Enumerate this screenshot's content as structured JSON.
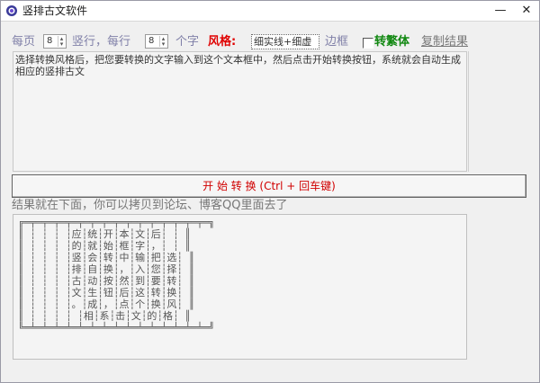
{
  "window": {
    "title": "竖排古文软件",
    "minimize_glyph": "—",
    "close_glyph": "✕"
  },
  "toolbar": {
    "per_page_label": "每页",
    "columns_value": "8",
    "columns_suffix": "竖行，每行",
    "chars_value": "8",
    "chars_suffix": "个字",
    "style_label": "风格:",
    "style_value": "细实线+细虚",
    "border_label": "边框",
    "traditional_checked": false,
    "traditional_label": "转繁体",
    "copy_label": "复制结果"
  },
  "input": {
    "text": "选择转换风格后，把您要转换的文字输入到这个文本框中，然后点击开始转换按钮，系统就会自动生成相应的竖排古文"
  },
  "start_button": {
    "label": "开 始 转 换  (Ctrl + 回车键)"
  },
  "result": {
    "label": "结果就在下面，你可以拷贝到论坛、博客QQ里面去了",
    "output_text": "╔═╤═╤═╤═╤═╤═╤═╤═╤═╤═╤═╤═╤═╤═╤═╤═╗\n║ ┆ ┆ ┆ ┆应┆统┆开┆本┆文┆后┆ ┆ ║\n║ ┆ ┆ ┆ ┆的┆就┆始┆框┆字┆，┆ ┆ ║\n║ ┆ ┆ ┆ ┆竖┆会┆转┆中┆输┆把┆选┆ ║\n║ ┆ ┆ ┆ ┆排┆自┆换┆，┆入┆您┆择┆ ║\n║ ┆ ┆ ┆ ┆古┆动┆按┆然┆到┆要┆转┆ ║\n║ ┆ ┆ ┆ ┆文┆生┆钮┆后┆这┆转┆换┆ ║\n║ ┆ ┆ ┆ ┆。┆成┆，┆点┆个┆换┆风┆ ║\n║ ┆ ┆ ┆ ┆ ┆相┆系┆击┆文┆的┆格┆ ║\n╚═╧═╧═╧═╧═╧═╧═╧═╧═╧═╧═╧═╧═╧═╧═╧═╝"
  },
  "colors": {
    "style_label": "#e00000",
    "traditional_label": "#118811",
    "start_button_text": "#d00000",
    "toolbar_text": "#8080a8"
  }
}
